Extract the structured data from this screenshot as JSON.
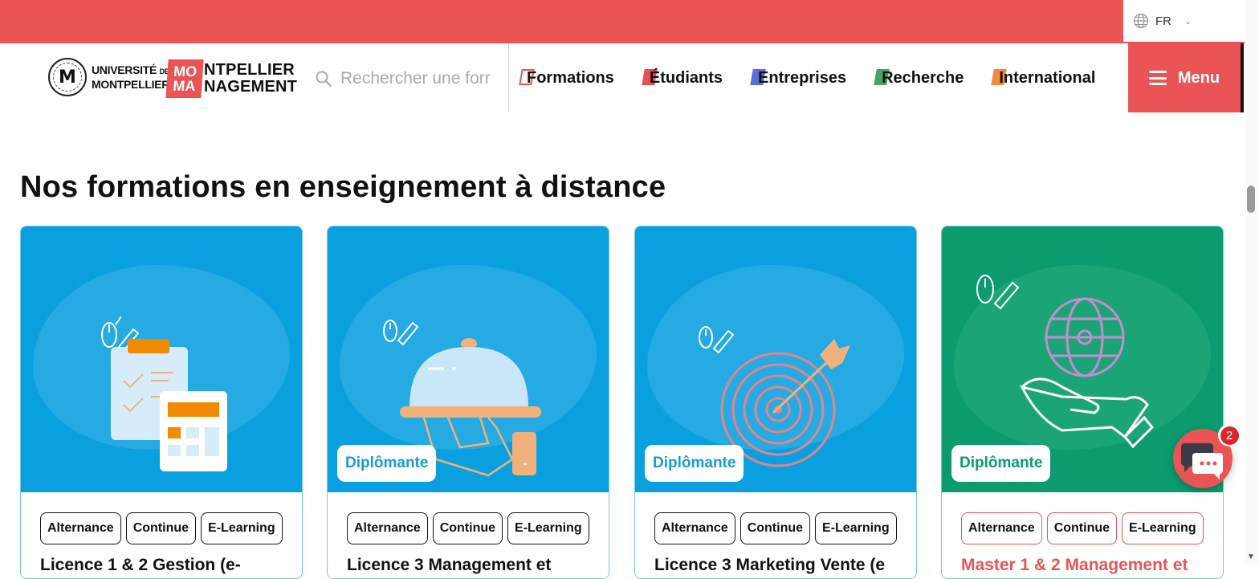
{
  "colors": {
    "brand_red": "#ea5455",
    "card_blue": "#0aa0e0",
    "card_green": "#0b9b6f",
    "blue_text": "#1a9bd7",
    "green_text": "#0b9b6f"
  },
  "topbar": {
    "language": {
      "icon": "globe-icon",
      "value": "FR"
    }
  },
  "header": {
    "university_logo": {
      "line1": "UNIVERSITÉ",
      "line1_small": "DE",
      "line2": "MONTPELLIER",
      "seal_letter": "M"
    },
    "school_logo": {
      "block_line1": "MO",
      "block_line2": "MA",
      "rest_line1": "NTPELLIER",
      "rest_line2": "NAGEMENT"
    },
    "search": {
      "placeholder": "Rechercher une forr"
    },
    "nav": [
      {
        "label": "Formations",
        "mark_color": "#ea5455"
      },
      {
        "label": "Étudiants",
        "mark_color": "#e84f55"
      },
      {
        "label": "Entreprises",
        "mark_color": "#5b6fd6"
      },
      {
        "label": "Recherche",
        "mark_color": "#4aa35e"
      },
      {
        "label": "International",
        "mark_color": "#f08a3c"
      }
    ],
    "menu_label": "Menu"
  },
  "section": {
    "title": "Nos formations en enseignement à distance"
  },
  "cards": [
    {
      "illustration": "clipboard-calculator-icon",
      "badge": "",
      "tags": [
        "Alternance",
        "Continue",
        "E-Learning"
      ],
      "title": "Licence 1 & 2 Gestion (e-"
    },
    {
      "illustration": "service-cloche-icon",
      "badge": "Diplômante",
      "tags": [
        "Alternance",
        "Continue",
        "E-Learning"
      ],
      "title": "Licence 3 Management et"
    },
    {
      "illustration": "target-arrow-icon",
      "badge": "Diplômante",
      "tags": [
        "Alternance",
        "Continue",
        "E-Learning"
      ],
      "title": "Licence 3 Marketing Vente (e"
    },
    {
      "illustration": "globe-hand-icon",
      "badge": "Diplômante",
      "tags": [
        "Alternance",
        "Continue",
        "E-Learning"
      ],
      "title": "Master 1 & 2 Management et"
    }
  ],
  "chat": {
    "icon": "chat-bubble-icon",
    "unread_count": "2"
  }
}
